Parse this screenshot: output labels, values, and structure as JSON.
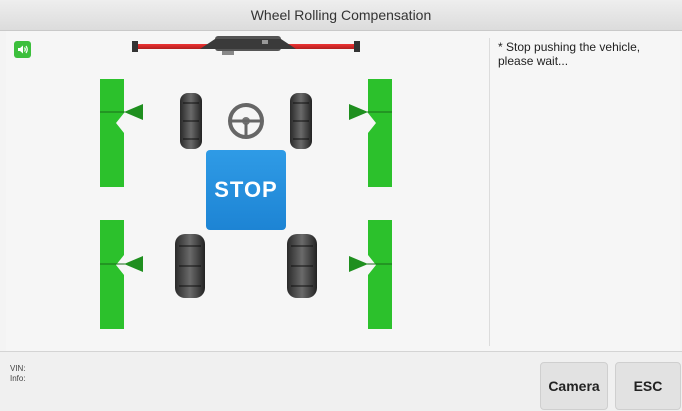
{
  "window": {
    "title": "Wheel Rolling Compensation"
  },
  "message": "* Stop pushing the vehicle, please wait...",
  "stop_sign": {
    "label": "STOP"
  },
  "footer": {
    "vin_label": "VIN:",
    "info_label": "Info:"
  },
  "buttons": {
    "camera": "Camera",
    "esc": "ESC"
  },
  "icons": {
    "sound": "speaker-icon",
    "steering": "steering-wheel-icon",
    "bar": "wheelbase-bar-icon"
  },
  "colors": {
    "target_green": "#2cc12c",
    "stop_blue": "#1e88d8",
    "bar_red": "#d62b2b",
    "marker_green": "#1f8f1f",
    "sound_green": "#3cbf3c"
  }
}
